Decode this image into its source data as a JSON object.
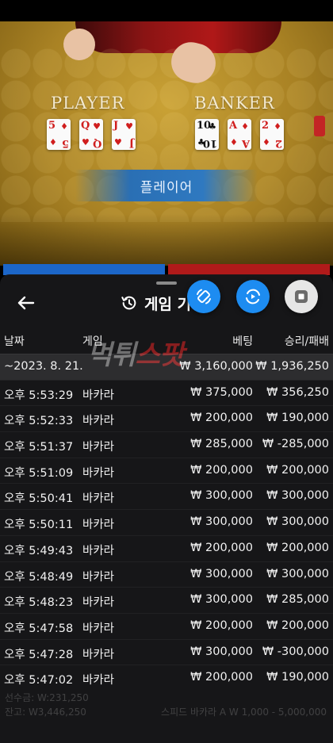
{
  "table": {
    "player_label": "PLAYER",
    "banker_label": "BANKER",
    "result_label": "플레이어",
    "player_cards": [
      {
        "rank": "5",
        "suit": "♦",
        "color": "red"
      },
      {
        "rank": "Q",
        "suit": "♥",
        "color": "red"
      },
      {
        "rank": "J",
        "suit": "♥",
        "color": "red"
      }
    ],
    "banker_cards": [
      {
        "rank": "10",
        "suit": "♣",
        "color": "blk"
      },
      {
        "rank": "A",
        "suit": "♦",
        "color": "red"
      },
      {
        "rank": "2",
        "suit": "♦",
        "color": "red"
      }
    ]
  },
  "history": {
    "title": "게임 기록",
    "columns": {
      "date": "날짜",
      "game": "게임",
      "bet": "베팅",
      "result": "승리/패배"
    },
    "total_row": {
      "date": "~2023. 8. 21.",
      "bet": "₩ 3,160,000",
      "result": "₩ 1,936,250"
    },
    "rows": [
      {
        "time": "오후 5:53:29",
        "game": "바카라",
        "bet": "₩ 375,000",
        "result": "₩ 356,250"
      },
      {
        "time": "오후 5:52:33",
        "game": "바카라",
        "bet": "₩ 200,000",
        "result": "₩ 190,000"
      },
      {
        "time": "오후 5:51:37",
        "game": "바카라",
        "bet": "₩ 285,000",
        "result": "₩ -285,000"
      },
      {
        "time": "오후 5:51:09",
        "game": "바카라",
        "bet": "₩ 200,000",
        "result": "₩ 200,000"
      },
      {
        "time": "오후 5:50:41",
        "game": "바카라",
        "bet": "₩ 300,000",
        "result": "₩ 300,000"
      },
      {
        "time": "오후 5:50:11",
        "game": "바카라",
        "bet": "₩ 300,000",
        "result": "₩ 300,000"
      },
      {
        "time": "오후 5:49:43",
        "game": "바카라",
        "bet": "₩ 200,000",
        "result": "₩ 200,000"
      },
      {
        "time": "오후 5:48:49",
        "game": "바카라",
        "bet": "₩ 300,000",
        "result": "₩ 300,000"
      },
      {
        "time": "오후 5:48:23",
        "game": "바카라",
        "bet": "₩ 300,000",
        "result": "₩ 285,000"
      },
      {
        "time": "오후 5:47:58",
        "game": "바카라",
        "bet": "₩ 200,000",
        "result": "₩ 200,000"
      },
      {
        "time": "오후 5:47:28",
        "game": "바카라",
        "bet": "₩ 300,000",
        "result": "₩ -300,000"
      },
      {
        "time": "오후 5:47:02",
        "game": "바카라",
        "bet": "₩ 200,000",
        "result": "₩ 190,000"
      }
    ]
  },
  "watermark": {
    "part1": "먹튀",
    "part2": "스팟"
  },
  "footer": {
    "left_1": "선수금: W:231,250",
    "left_2": "잔고: W3,446,250",
    "right": "스피드 바카라 A  W 1,000 - 5,000,000"
  },
  "icons": {
    "back": "back-arrow-icon",
    "history": "history-clock-icon",
    "rotate": "rotate-screen-icon",
    "replay": "replay-icon",
    "stop": "stop-icon"
  },
  "colors": {
    "accent_blue": "#1d8cf1",
    "banker_red": "#b01a1a",
    "player_blue": "#1c66c8",
    "felt_gold": "#b38a26"
  }
}
